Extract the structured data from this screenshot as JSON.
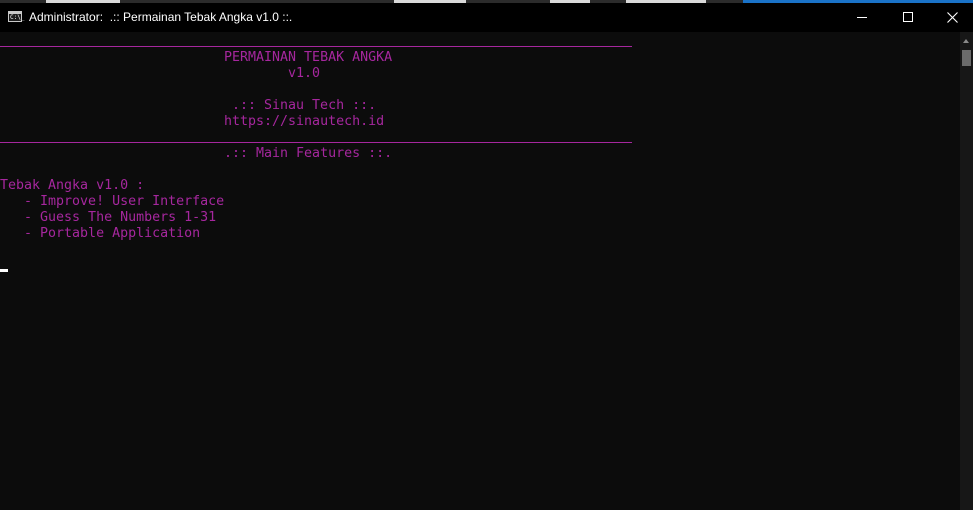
{
  "window": {
    "title": "Administrator:  .:: Permainan Tebak Angka v1.0 ::.",
    "icon_glyph": "C:\\_",
    "icon": "console-icon",
    "controls": [
      "minimize-icon",
      "maximize-icon",
      "close-icon"
    ]
  },
  "console": {
    "text_color": "#a6279e",
    "background": "#0c0c0c",
    "lines": {
      "title": "PERMAINAN TEBAK ANGKA",
      "version": "v1.0",
      "author": ".:: Sinau Tech ::.",
      "url": "https://sinautech.id",
      "features_header": ".:: Main Features ::.",
      "app_line": "Tebak Angka v1.0 :",
      "feature_1": "   - Improve! User Interface",
      "feature_2": "   - Guess The Numbers 1-31",
      "feature_3": "   - Portable Application"
    }
  }
}
